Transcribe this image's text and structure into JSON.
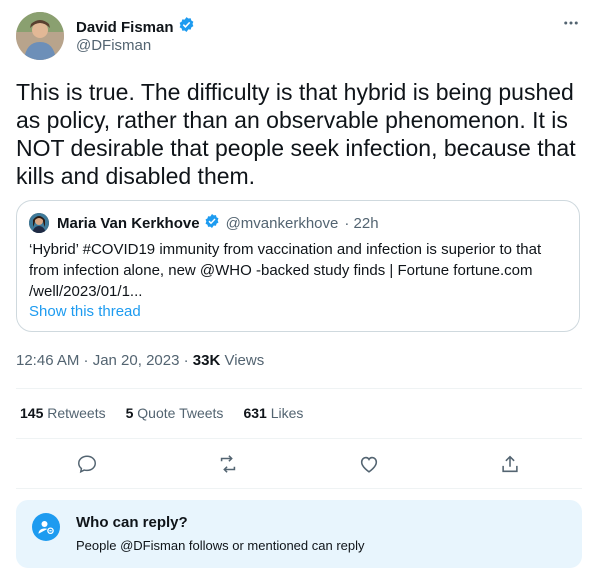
{
  "author": {
    "name": "David Fisman",
    "handle": "@DFisman",
    "verified_icon": "verified-badge-icon"
  },
  "tweet": {
    "text": "This is true.  The difficulty is that hybrid is being pushed as policy, rather than an observable phenomenon.  It is NOT desirable that people seek infection, because that kills and disabled them."
  },
  "quote": {
    "name": "Maria Van Kerkhove",
    "handle": "@mvankerkhove",
    "time": "· 22h",
    "text": "‘Hybrid’ #COVID19 immunity from vaccination and infection is superior to that from infection alone, new @WHO -backed study finds | Fortune fortune.com /well/2023/01/1...",
    "show_thread": "Show this thread"
  },
  "meta": {
    "timestamp": "12:46 AM · Jan 20, 2023 · ",
    "views_count": "33K",
    "views_label": " Views"
  },
  "stats": {
    "retweets": {
      "count": "145",
      "label": "Retweets"
    },
    "quotes": {
      "count": "5",
      "label": "Quote Tweets"
    },
    "likes": {
      "count": "631",
      "label": "Likes"
    }
  },
  "who_can_reply": {
    "title": "Who can reply?",
    "subtitle": "People @DFisman follows or mentioned can reply"
  },
  "colors": {
    "accent": "#1d9bf0",
    "text": "#0f1419",
    "muted": "#536471",
    "reply_bg": "#e8f5fd"
  }
}
